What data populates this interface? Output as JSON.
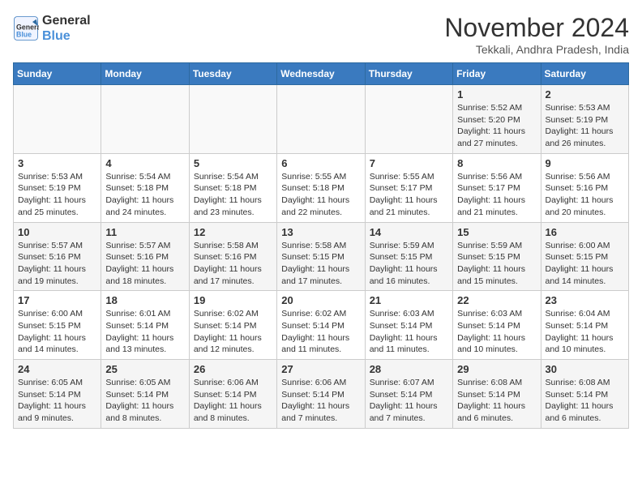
{
  "logo": {
    "line1": "General",
    "line2": "Blue"
  },
  "title": "November 2024",
  "location": "Tekkali, Andhra Pradesh, India",
  "days_of_week": [
    "Sunday",
    "Monday",
    "Tuesday",
    "Wednesday",
    "Thursday",
    "Friday",
    "Saturday"
  ],
  "weeks": [
    [
      {
        "day": "",
        "sunrise": "",
        "sunset": "",
        "daylight": ""
      },
      {
        "day": "",
        "sunrise": "",
        "sunset": "",
        "daylight": ""
      },
      {
        "day": "",
        "sunrise": "",
        "sunset": "",
        "daylight": ""
      },
      {
        "day": "",
        "sunrise": "",
        "sunset": "",
        "daylight": ""
      },
      {
        "day": "",
        "sunrise": "",
        "sunset": "",
        "daylight": ""
      },
      {
        "day": "1",
        "sunrise": "Sunrise: 5:52 AM",
        "sunset": "Sunset: 5:20 PM",
        "daylight": "Daylight: 11 hours and 27 minutes."
      },
      {
        "day": "2",
        "sunrise": "Sunrise: 5:53 AM",
        "sunset": "Sunset: 5:19 PM",
        "daylight": "Daylight: 11 hours and 26 minutes."
      }
    ],
    [
      {
        "day": "3",
        "sunrise": "Sunrise: 5:53 AM",
        "sunset": "Sunset: 5:19 PM",
        "daylight": "Daylight: 11 hours and 25 minutes."
      },
      {
        "day": "4",
        "sunrise": "Sunrise: 5:54 AM",
        "sunset": "Sunset: 5:18 PM",
        "daylight": "Daylight: 11 hours and 24 minutes."
      },
      {
        "day": "5",
        "sunrise": "Sunrise: 5:54 AM",
        "sunset": "Sunset: 5:18 PM",
        "daylight": "Daylight: 11 hours and 23 minutes."
      },
      {
        "day": "6",
        "sunrise": "Sunrise: 5:55 AM",
        "sunset": "Sunset: 5:18 PM",
        "daylight": "Daylight: 11 hours and 22 minutes."
      },
      {
        "day": "7",
        "sunrise": "Sunrise: 5:55 AM",
        "sunset": "Sunset: 5:17 PM",
        "daylight": "Daylight: 11 hours and 21 minutes."
      },
      {
        "day": "8",
        "sunrise": "Sunrise: 5:56 AM",
        "sunset": "Sunset: 5:17 PM",
        "daylight": "Daylight: 11 hours and 21 minutes."
      },
      {
        "day": "9",
        "sunrise": "Sunrise: 5:56 AM",
        "sunset": "Sunset: 5:16 PM",
        "daylight": "Daylight: 11 hours and 20 minutes."
      }
    ],
    [
      {
        "day": "10",
        "sunrise": "Sunrise: 5:57 AM",
        "sunset": "Sunset: 5:16 PM",
        "daylight": "Daylight: 11 hours and 19 minutes."
      },
      {
        "day": "11",
        "sunrise": "Sunrise: 5:57 AM",
        "sunset": "Sunset: 5:16 PM",
        "daylight": "Daylight: 11 hours and 18 minutes."
      },
      {
        "day": "12",
        "sunrise": "Sunrise: 5:58 AM",
        "sunset": "Sunset: 5:16 PM",
        "daylight": "Daylight: 11 hours and 17 minutes."
      },
      {
        "day": "13",
        "sunrise": "Sunrise: 5:58 AM",
        "sunset": "Sunset: 5:15 PM",
        "daylight": "Daylight: 11 hours and 17 minutes."
      },
      {
        "day": "14",
        "sunrise": "Sunrise: 5:59 AM",
        "sunset": "Sunset: 5:15 PM",
        "daylight": "Daylight: 11 hours and 16 minutes."
      },
      {
        "day": "15",
        "sunrise": "Sunrise: 5:59 AM",
        "sunset": "Sunset: 5:15 PM",
        "daylight": "Daylight: 11 hours and 15 minutes."
      },
      {
        "day": "16",
        "sunrise": "Sunrise: 6:00 AM",
        "sunset": "Sunset: 5:15 PM",
        "daylight": "Daylight: 11 hours and 14 minutes."
      }
    ],
    [
      {
        "day": "17",
        "sunrise": "Sunrise: 6:00 AM",
        "sunset": "Sunset: 5:15 PM",
        "daylight": "Daylight: 11 hours and 14 minutes."
      },
      {
        "day": "18",
        "sunrise": "Sunrise: 6:01 AM",
        "sunset": "Sunset: 5:14 PM",
        "daylight": "Daylight: 11 hours and 13 minutes."
      },
      {
        "day": "19",
        "sunrise": "Sunrise: 6:02 AM",
        "sunset": "Sunset: 5:14 PM",
        "daylight": "Daylight: 11 hours and 12 minutes."
      },
      {
        "day": "20",
        "sunrise": "Sunrise: 6:02 AM",
        "sunset": "Sunset: 5:14 PM",
        "daylight": "Daylight: 11 hours and 11 minutes."
      },
      {
        "day": "21",
        "sunrise": "Sunrise: 6:03 AM",
        "sunset": "Sunset: 5:14 PM",
        "daylight": "Daylight: 11 hours and 11 minutes."
      },
      {
        "day": "22",
        "sunrise": "Sunrise: 6:03 AM",
        "sunset": "Sunset: 5:14 PM",
        "daylight": "Daylight: 11 hours and 10 minutes."
      },
      {
        "day": "23",
        "sunrise": "Sunrise: 6:04 AM",
        "sunset": "Sunset: 5:14 PM",
        "daylight": "Daylight: 11 hours and 10 minutes."
      }
    ],
    [
      {
        "day": "24",
        "sunrise": "Sunrise: 6:05 AM",
        "sunset": "Sunset: 5:14 PM",
        "daylight": "Daylight: 11 hours and 9 minutes."
      },
      {
        "day": "25",
        "sunrise": "Sunrise: 6:05 AM",
        "sunset": "Sunset: 5:14 PM",
        "daylight": "Daylight: 11 hours and 8 minutes."
      },
      {
        "day": "26",
        "sunrise": "Sunrise: 6:06 AM",
        "sunset": "Sunset: 5:14 PM",
        "daylight": "Daylight: 11 hours and 8 minutes."
      },
      {
        "day": "27",
        "sunrise": "Sunrise: 6:06 AM",
        "sunset": "Sunset: 5:14 PM",
        "daylight": "Daylight: 11 hours and 7 minutes."
      },
      {
        "day": "28",
        "sunrise": "Sunrise: 6:07 AM",
        "sunset": "Sunset: 5:14 PM",
        "daylight": "Daylight: 11 hours and 7 minutes."
      },
      {
        "day": "29",
        "sunrise": "Sunrise: 6:08 AM",
        "sunset": "Sunset: 5:14 PM",
        "daylight": "Daylight: 11 hours and 6 minutes."
      },
      {
        "day": "30",
        "sunrise": "Sunrise: 6:08 AM",
        "sunset": "Sunset: 5:14 PM",
        "daylight": "Daylight: 11 hours and 6 minutes."
      }
    ]
  ]
}
